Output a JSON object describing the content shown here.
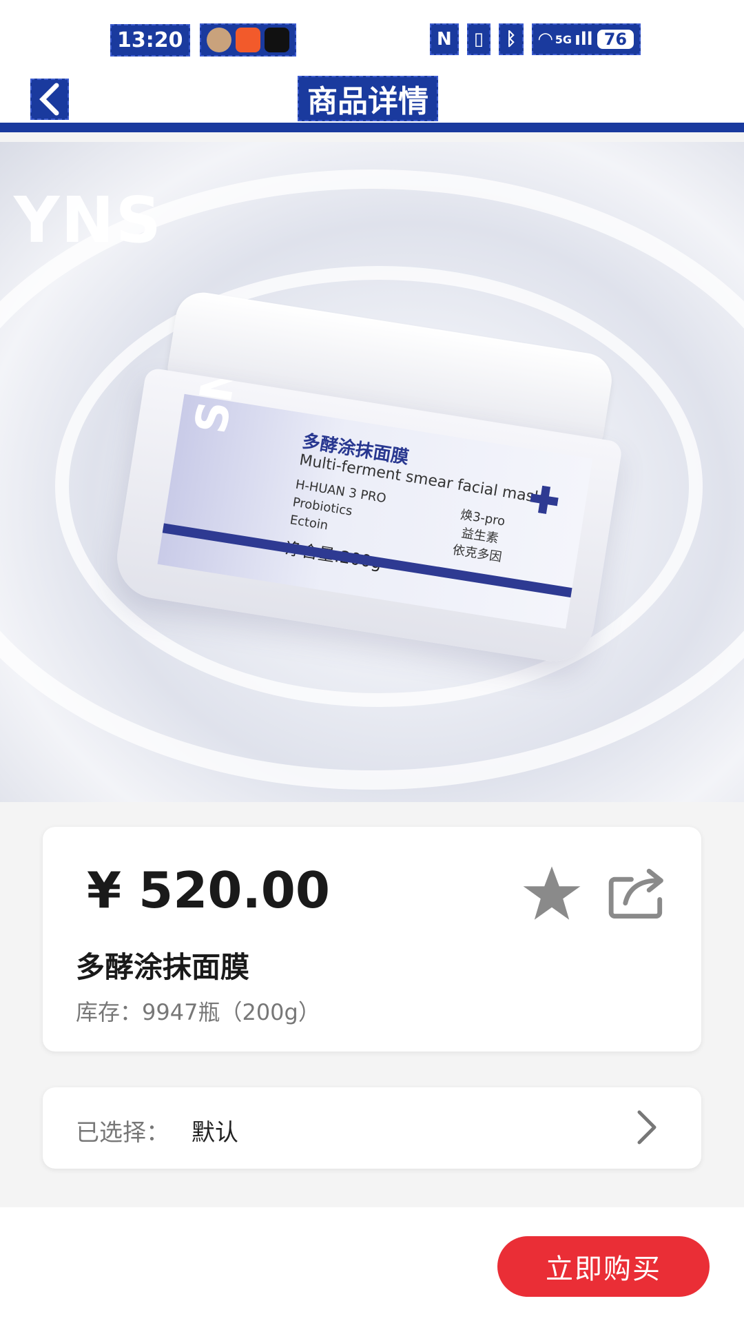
{
  "status_bar": {
    "time": "13:20",
    "signal": "5G",
    "battery": "76"
  },
  "navbar": {
    "title": "商品详情"
  },
  "hero": {
    "brand_mark": "YNS",
    "label": {
      "brand": "SNS",
      "name_cn": "多酵涂抹面膜",
      "name_en": "Multi-ferment smear facial mask",
      "ingredients_en": [
        "H-HUAN 3 PRO",
        "Probiotics",
        "Ectoin"
      ],
      "ingredients_cn": [
        "焕3-pro",
        "益生素",
        "依克多因"
      ],
      "net_content": "净含量:200g"
    }
  },
  "product": {
    "price": "¥ 520.00",
    "name": "多酵涂抹面膜",
    "stock_label": "库存：",
    "stock_value": "9947瓶（200g）"
  },
  "selection": {
    "label": "已选择：",
    "value": "默认"
  },
  "actions": {
    "buy_label": "立即购买"
  },
  "colors": {
    "accent": "#1a3a9e",
    "buy": "#ea2e36",
    "icon_gray": "#8a8a8a"
  },
  "icons": {
    "back": "chevron-left-icon",
    "favorite": "star-icon",
    "share": "share-icon",
    "select": "chevron-right-icon"
  }
}
